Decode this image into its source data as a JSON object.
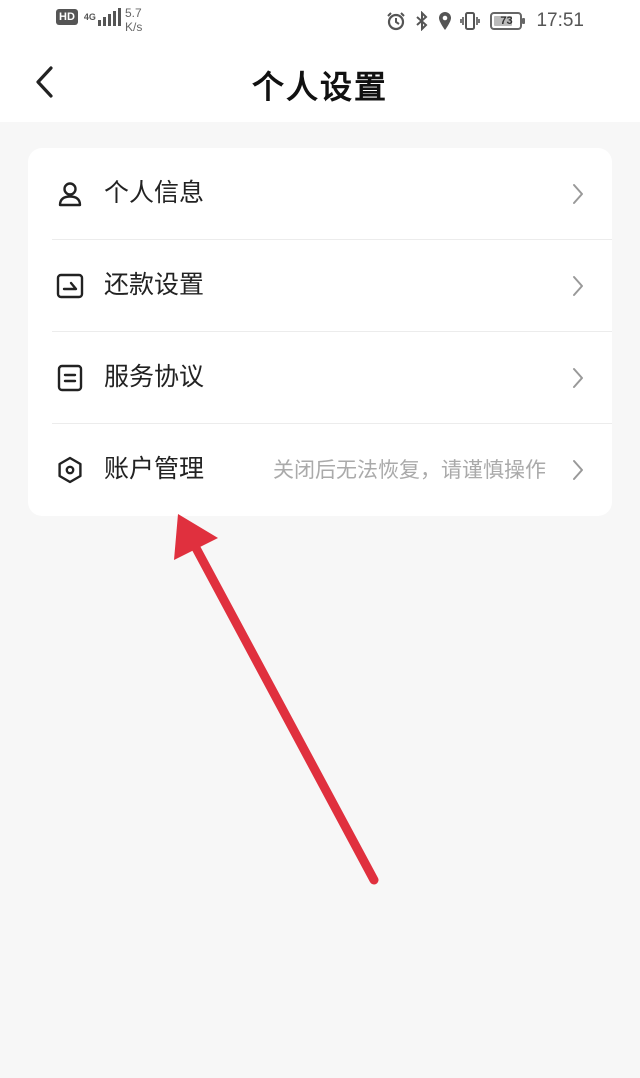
{
  "status_bar": {
    "hd": "HD",
    "network": "4G",
    "speed_value": "5.7",
    "speed_unit": "K/s",
    "battery": "73",
    "battery_level": 0.73,
    "time": "17:51"
  },
  "header": {
    "title": "个人设置"
  },
  "settings": {
    "items": [
      {
        "label": "个人信息",
        "hint": "",
        "icon": "person-icon"
      },
      {
        "label": "还款设置",
        "hint": "",
        "icon": "repayment-icon"
      },
      {
        "label": "服务协议",
        "hint": "",
        "icon": "document-icon"
      },
      {
        "label": "账户管理",
        "hint": "关闭后无法恢复，请谨慎操作",
        "icon": "hexagon-settings-icon"
      }
    ]
  },
  "colors": {
    "annotation_arrow": "#e0303e",
    "background": "#f7f7f7",
    "card": "#ffffff"
  }
}
